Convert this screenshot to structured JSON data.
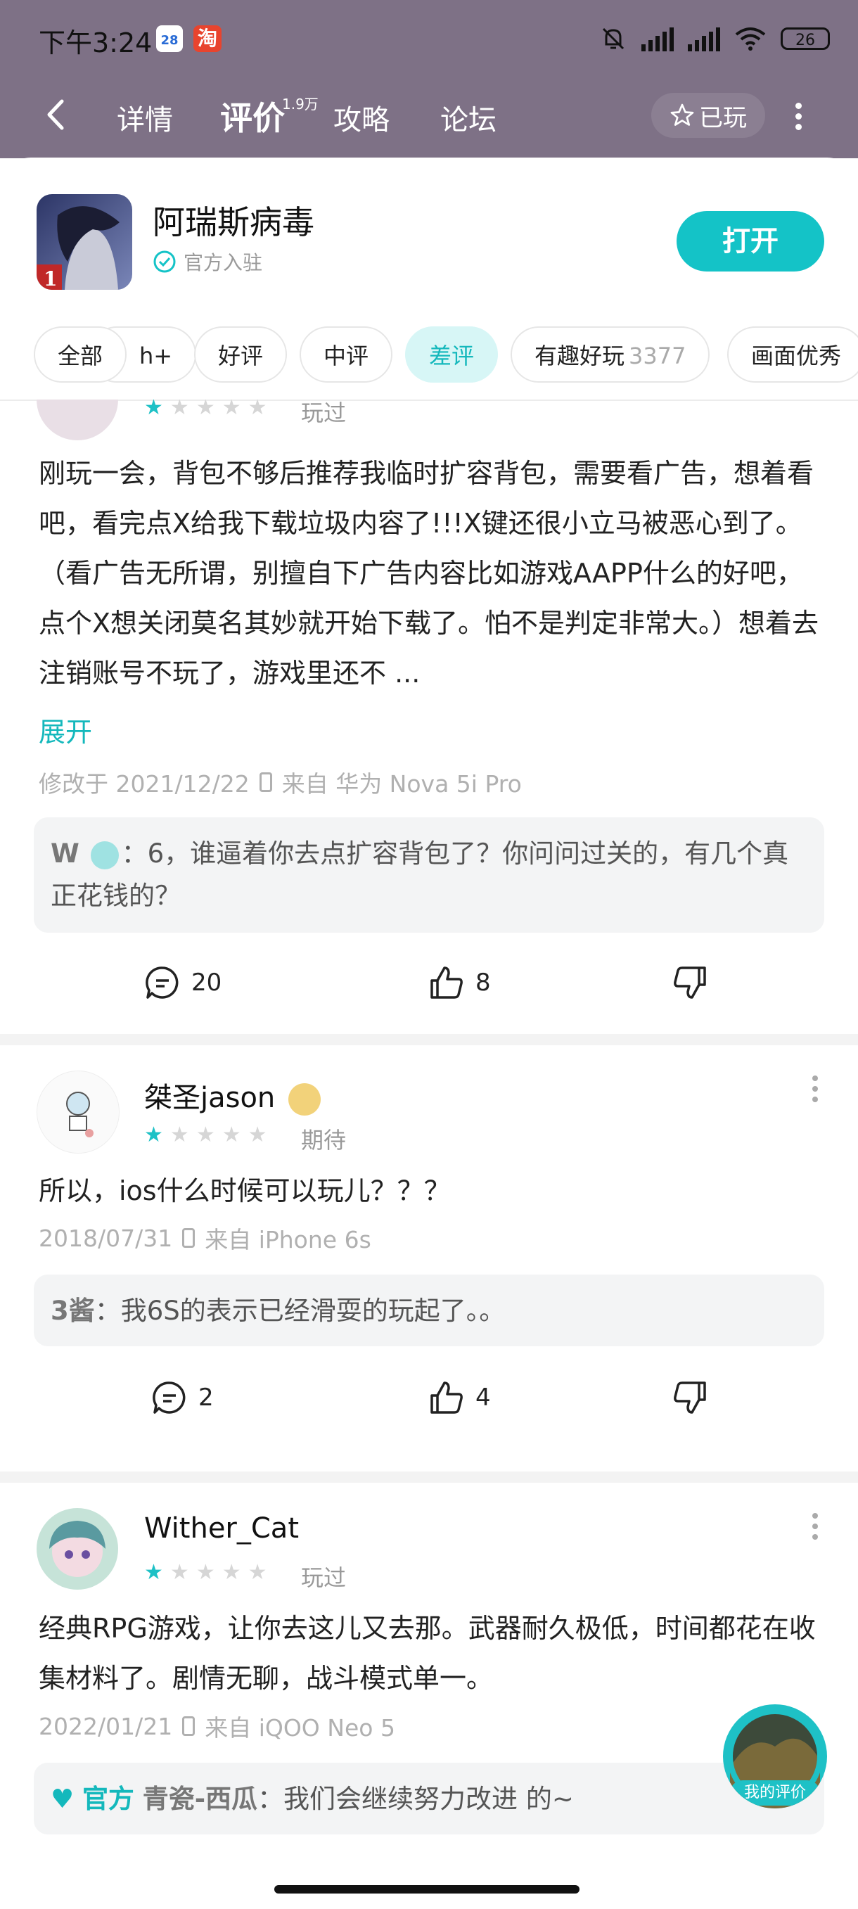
{
  "status_bar": {
    "time": "下午3:24",
    "calendar_day": "28",
    "taobao_glyph": "淘",
    "battery": "26"
  },
  "nav": {
    "tabs": [
      {
        "label": "详情"
      },
      {
        "label": "评价",
        "badge": "1.9万"
      },
      {
        "label": "攻略"
      },
      {
        "label": "论坛"
      }
    ],
    "played_label": "已玩"
  },
  "app": {
    "name": "阿瑞斯病毒",
    "verified_label": "官方入驻",
    "open_label": "打开"
  },
  "filters": {
    "chips": [
      {
        "label": "全部"
      },
      {
        "label": "h+"
      },
      {
        "label": "好评"
      },
      {
        "label": "中评"
      },
      {
        "label": "差评"
      },
      {
        "label": "有趣好玩",
        "count": "3377"
      },
      {
        "label": "画面优秀"
      }
    ],
    "active": "差评"
  },
  "reviews": [
    {
      "status": "玩过",
      "rating": 1,
      "text": "刚玩一会，背包不够后推荐我临时扩容背包，需要看广告，想着看吧，看完点X给我下载垃圾内容了!!!X键还很小立马被恶心到了。（看广告无所谓，别擅自下广告内容比如游戏AAPP什么的好吧，点个X想关闭莫名其妙就开始下载了。怕不是判定非常大。）想着去注销账号不玩了，游戏里还不 ...",
      "expand_label": "展开",
      "date": "修改于 2021/12/22",
      "device": "来自 华为 Nova 5i Pro",
      "reply_user": "W",
      "reply_text": "：6，谁逼着你去点扩容背包了？你问问过关的，有几个真正花钱的？",
      "comments": "20",
      "likes": "8"
    },
    {
      "user": "桀圣jason",
      "status": "期待",
      "rating": 1,
      "text": "所以，ios什么时候可以玩儿？？？",
      "date": "2018/07/31",
      "device": "来自 iPhone 6s",
      "reply_user": "3酱",
      "reply_text": "：我6S的表示已经滑耍的玩起了。。",
      "comments": "2",
      "likes": "4"
    },
    {
      "user": "Wither_Cat",
      "status": "玩过",
      "rating": 1,
      "text": "经典RPG游戏，让你去这儿又去那。武器耐久极低，时间都花在收集材料了。剧情无聊，战斗模式单一。",
      "date": "2022/01/21",
      "device": "来自 iQOO Neo 5",
      "official_label": "官方",
      "reply_user": "青瓷-西瓜",
      "reply_text": "：我们会继续努力改进 的~"
    }
  ],
  "my_review_label": "我的评价",
  "colors": {
    "accent": "#14c3c7",
    "header_bg": "#7e7186"
  }
}
